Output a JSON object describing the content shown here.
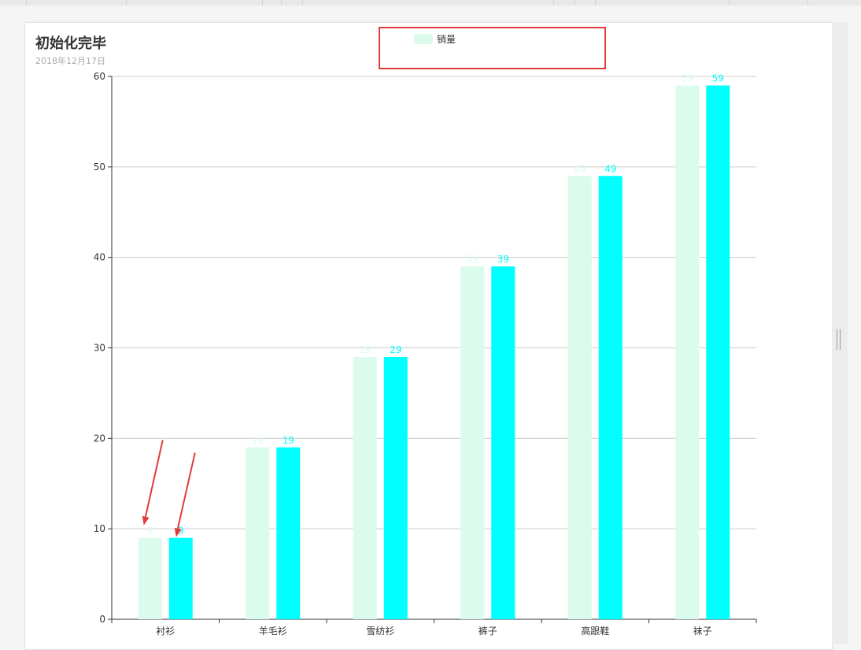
{
  "title": "初始化完毕",
  "subtitle": "2018年12月17日",
  "legend": {
    "label": "销量",
    "color": "#dbfcec"
  },
  "colors": {
    "series_1": "#dbfcec",
    "series_2": "#00ffff",
    "grid": "#cccccc",
    "axis": "#333333",
    "annotation": "#e23b3b"
  },
  "chart_data": {
    "type": "bar",
    "categories": [
      "衬衫",
      "羊毛衫",
      "雪纺衫",
      "裤子",
      "高跟鞋",
      "袜子"
    ],
    "series": [
      {
        "name": "销量",
        "values": [
          9,
          19,
          29,
          39,
          49,
          59
        ],
        "color": "#dbfcec"
      },
      {
        "values": [
          9,
          19,
          29,
          39,
          49,
          59
        ],
        "color": "#00ffff"
      }
    ],
    "ylim": [
      0,
      60
    ],
    "yticks": [
      0,
      10,
      20,
      30,
      40,
      50,
      60
    ],
    "grid": true,
    "legend_position": "top-center",
    "data_labels": true,
    "annotations": [
      {
        "type": "arrow",
        "points_to": "衬衫 series 1 bar top"
      },
      {
        "type": "arrow",
        "points_to": "衬衫 series 2 bar top"
      },
      {
        "type": "highlight-box",
        "around": "legend"
      }
    ]
  }
}
